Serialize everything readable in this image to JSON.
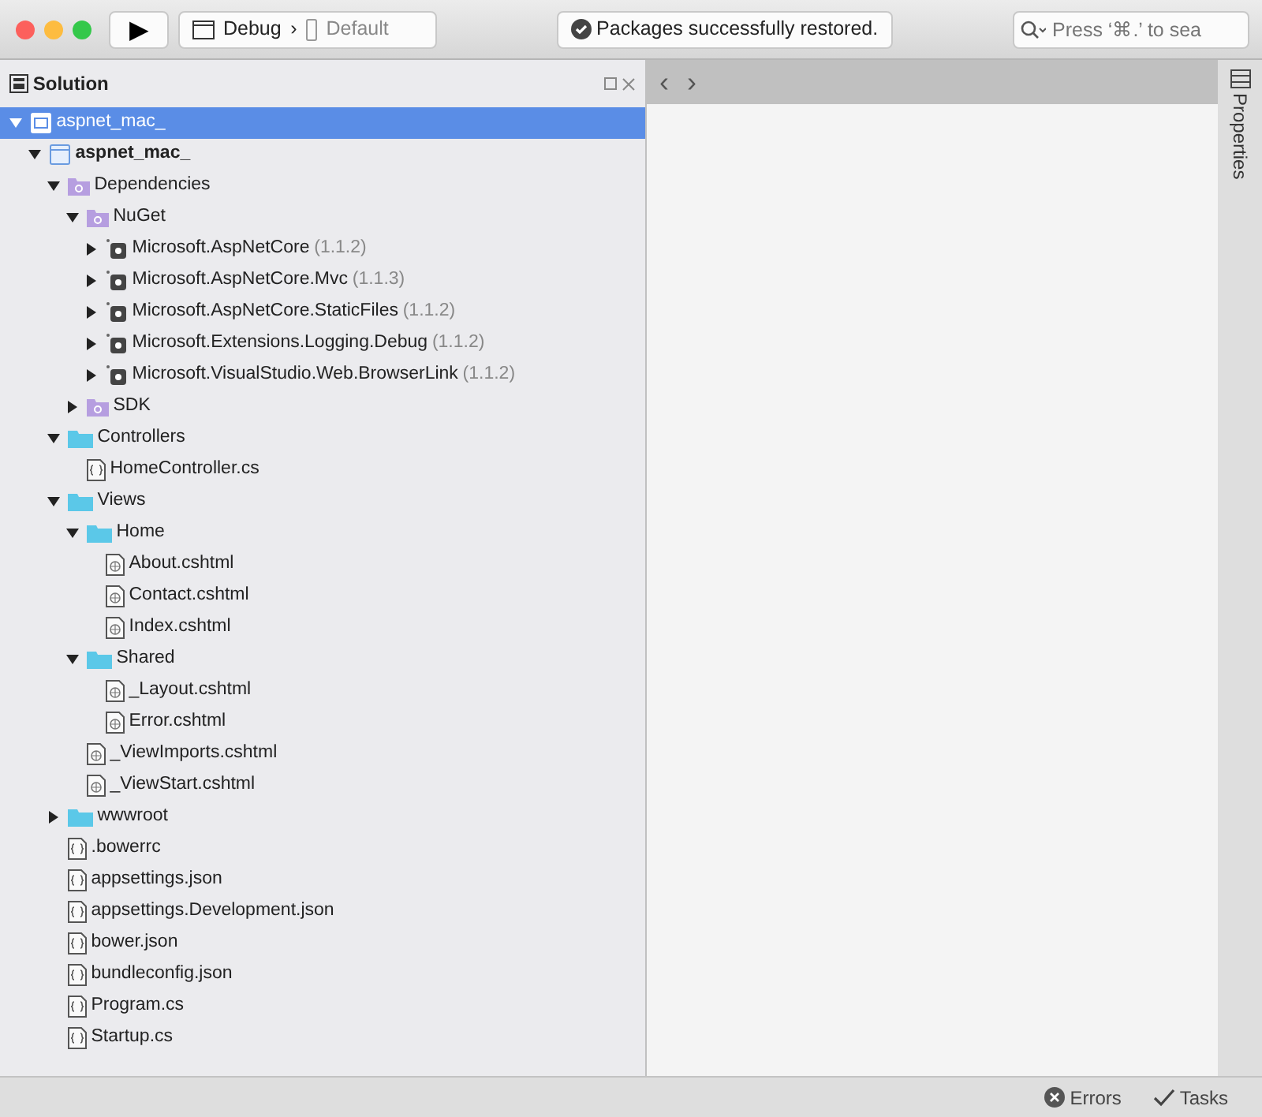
{
  "toolbar": {
    "run_button": "▶",
    "configuration": "Debug",
    "separator": "›",
    "device": "Default",
    "status": "Packages successfully restored.",
    "search": {
      "placeholder": "Press ‘⌘.’ to sea"
    }
  },
  "solution_pad": {
    "title": "Solution",
    "tree": [
      {
        "label": "aspnet_mac_",
        "kind": "solution",
        "selected": true,
        "expanded": true,
        "children": [
          {
            "label": "aspnet_mac_",
            "kind": "project",
            "selected": false,
            "expanded": true,
            "children": [
              {
                "label": "Dependencies",
                "kind": "deps",
                "selected": false,
                "expanded": true,
                "children": [
                  {
                    "label": "NuGet",
                    "kind": "deps",
                    "selected": false,
                    "expanded": true,
                    "children": [
                      {
                        "label": "Microsoft.AspNetCore",
                        "version": "(1.1.2)",
                        "kind": "package",
                        "selected": false,
                        "expanded": false
                      },
                      {
                        "label": "Microsoft.AspNetCore.Mvc",
                        "version": "(1.1.3)",
                        "kind": "package",
                        "selected": false,
                        "expanded": false
                      },
                      {
                        "label": "Microsoft.AspNetCore.StaticFiles",
                        "version": "(1.1.2)",
                        "kind": "package",
                        "selected": false,
                        "expanded": false
                      },
                      {
                        "label": "Microsoft.Extensions.Logging.Debug",
                        "version": "(1.1.2)",
                        "kind": "package",
                        "selected": false,
                        "expanded": false
                      },
                      {
                        "label": "Microsoft.VisualStudio.Web.BrowserLink",
                        "version": "(1.1.2)",
                        "kind": "package",
                        "selected": false,
                        "expanded": false
                      }
                    ]
                  },
                  {
                    "label": "SDK",
                    "kind": "deps",
                    "selected": false,
                    "expanded": false
                  }
                ]
              },
              {
                "label": "Controllers",
                "kind": "folder",
                "selected": false,
                "expanded": true,
                "children": [
                  {
                    "label": "HomeController.cs",
                    "kind": "code",
                    "selected": false
                  }
                ]
              },
              {
                "label": "Views",
                "kind": "folder",
                "selected": false,
                "expanded": true,
                "children": [
                  {
                    "label": "Home",
                    "kind": "folder",
                    "selected": false,
                    "expanded": true,
                    "children": [
                      {
                        "label": "About.cshtml",
                        "kind": "razor",
                        "selected": false
                      },
                      {
                        "label": "Contact.cshtml",
                        "kind": "razor",
                        "selected": false
                      },
                      {
                        "label": "Index.cshtml",
                        "kind": "razor",
                        "selected": false
                      }
                    ]
                  },
                  {
                    "label": "Shared",
                    "kind": "folder",
                    "selected": false,
                    "expanded": true,
                    "children": [
                      {
                        "label": "_Layout.cshtml",
                        "kind": "razor",
                        "selected": false
                      },
                      {
                        "label": "Error.cshtml",
                        "kind": "razor",
                        "selected": false
                      }
                    ]
                  },
                  {
                    "label": "_ViewImports.cshtml",
                    "kind": "razor",
                    "selected": false
                  },
                  {
                    "label": "_ViewStart.cshtml",
                    "kind": "razor",
                    "selected": false
                  }
                ]
              },
              {
                "label": "wwwroot",
                "kind": "folder",
                "selected": false,
                "expanded": false
              },
              {
                "label": ".bowerrc",
                "kind": "code",
                "selected": false
              },
              {
                "label": "appsettings.json",
                "kind": "code",
                "selected": false
              },
              {
                "label": "appsettings.Development.json",
                "kind": "code",
                "selected": false
              },
              {
                "label": "bower.json",
                "kind": "code",
                "selected": false
              },
              {
                "label": "bundleconfig.json",
                "kind": "code",
                "selected": false
              },
              {
                "label": "Program.cs",
                "kind": "code",
                "selected": false
              },
              {
                "label": "Startup.cs",
                "kind": "code",
                "selected": false
              }
            ]
          }
        ]
      }
    ]
  },
  "editor": {
    "back": "‹",
    "forward": "›"
  },
  "side_tab": "Properties",
  "status_bar": [
    {
      "label": "Errors",
      "kind": "errors"
    },
    {
      "label": "Tasks",
      "kind": "tasks"
    }
  ]
}
